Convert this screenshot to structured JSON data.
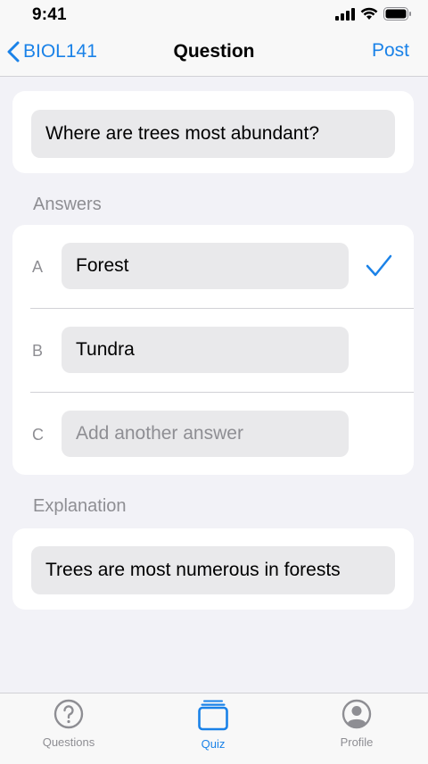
{
  "status": {
    "time": "9:41"
  },
  "nav": {
    "back_label": "BIOL141",
    "title": "Question",
    "post_label": "Post"
  },
  "question": {
    "text": "Where are trees most abundant?"
  },
  "answers": {
    "section_label": "Answers",
    "items": [
      {
        "letter": "A",
        "text": "Forest",
        "correct": true
      },
      {
        "letter": "B",
        "text": "Tundra",
        "correct": false
      },
      {
        "letter": "C",
        "placeholder": "Add another answer"
      }
    ]
  },
  "explanation": {
    "section_label": "Explanation",
    "text": "Trees are most numerous in forests"
  },
  "tabs": [
    {
      "label": "Questions",
      "icon": "question-circle-icon",
      "active": false
    },
    {
      "label": "Quiz",
      "icon": "card-stack-icon",
      "active": true
    },
    {
      "label": "Profile",
      "icon": "person-circle-icon",
      "active": false
    }
  ],
  "colors": {
    "accent": "#1a82e8",
    "background": "#f2f2f7",
    "field": "#e9e9eb",
    "secondary_text": "#8e8e93"
  }
}
